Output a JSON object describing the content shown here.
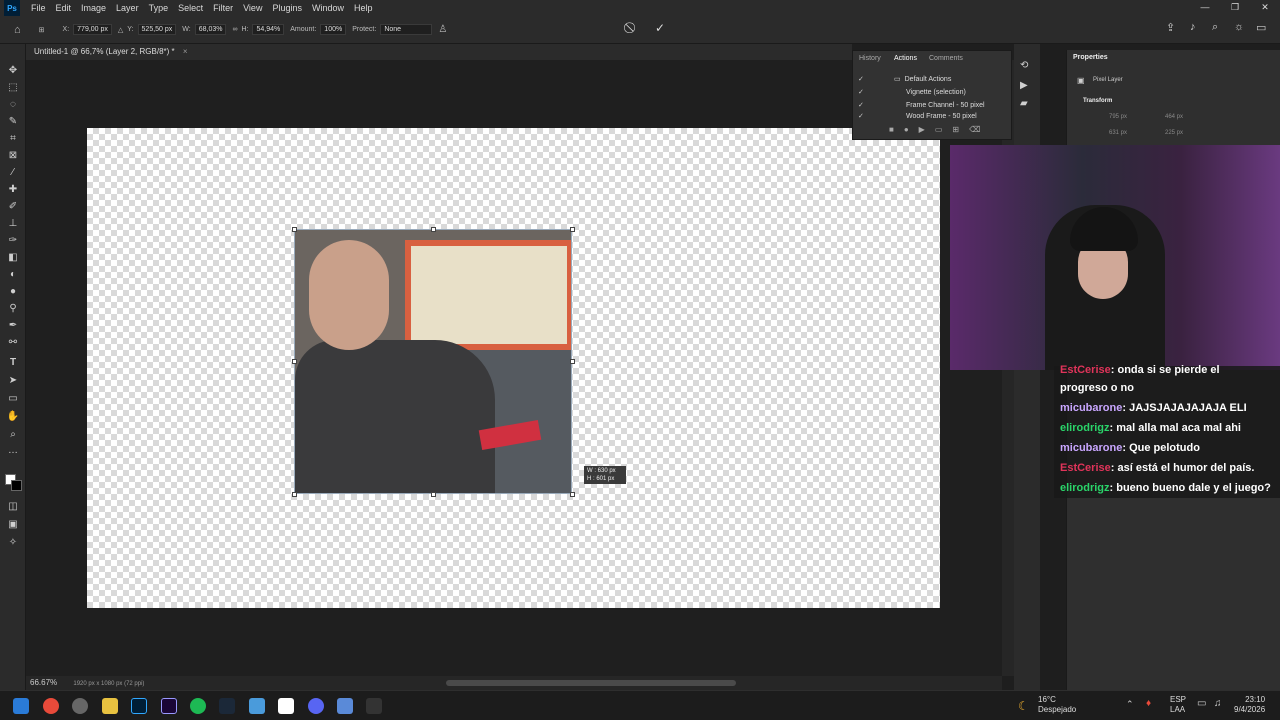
{
  "app": {
    "logo": "Ps",
    "menu": [
      "File",
      "Edit",
      "Image",
      "Layer",
      "Type",
      "Select",
      "Filter",
      "View",
      "Plugins",
      "Window",
      "Help"
    ],
    "window_controls": [
      "—",
      "❐",
      "✕"
    ]
  },
  "options": {
    "x_label": "X:",
    "x_value": "779,00 px",
    "y_label": "Y:",
    "y_value": "525,50 px",
    "w_label": "W:",
    "w_value": "68,03%",
    "h_label": "H:",
    "h_value": "54,94%",
    "amount_label": "Amount:",
    "amount_value": "100%",
    "protect_label": "Protect:",
    "protect_value": "None",
    "cancel_icon": "⃠",
    "commit_icon": "✓"
  },
  "document": {
    "tab_title": "Untitled-1 @ 66,7% (Layer 2, RGB/8*) *",
    "zoom": "66.67%",
    "size_info": "1920 px x 1080 px (72 ppi)",
    "transform_tip_w": "W : 630 px",
    "transform_tip_h": "H : 601 px"
  },
  "actions_panel": {
    "tabs": [
      "History",
      "Actions",
      "Comments"
    ],
    "rows": [
      "Default Actions",
      "Vignette (selection)",
      "Frame Channel - 50 pixel",
      "Wood Frame - 50 pixel"
    ]
  },
  "properties_panel": {
    "title": "Properties",
    "layer_type": "Pixel Layer",
    "section": "Transform",
    "w": "795 px",
    "h": "631 px",
    "x": "464 px",
    "y": "225 px"
  },
  "chat": [
    {
      "user": "EstCerise",
      "text": ": onda si se pierde el",
      "color": "red"
    },
    {
      "user": "",
      "text": "progreso o no",
      "color": ""
    },
    {
      "user": "micubarone",
      "text": ": JAJSJAJAJAJAJA ELI",
      "color": "purple"
    },
    {
      "user": "elirodrigz",
      "text": ": mal alla mal aca mal ahi",
      "color": "green"
    },
    {
      "user": "micubarone",
      "text": ": Que pelotudo",
      "color": "purple"
    },
    {
      "user": "EstCerise",
      "text": ": así está el humor del país.",
      "color": "red"
    },
    {
      "user": "elirodrigz",
      "text": ": bueno bueno dale y el juego?",
      "color": "green"
    }
  ],
  "taskbar": {
    "weather_temp": "16°C",
    "weather_desc": "Despejado",
    "lang_1": "ESP",
    "lang_2": "LAA",
    "time": "23:10",
    "date": "9/4/2026"
  }
}
